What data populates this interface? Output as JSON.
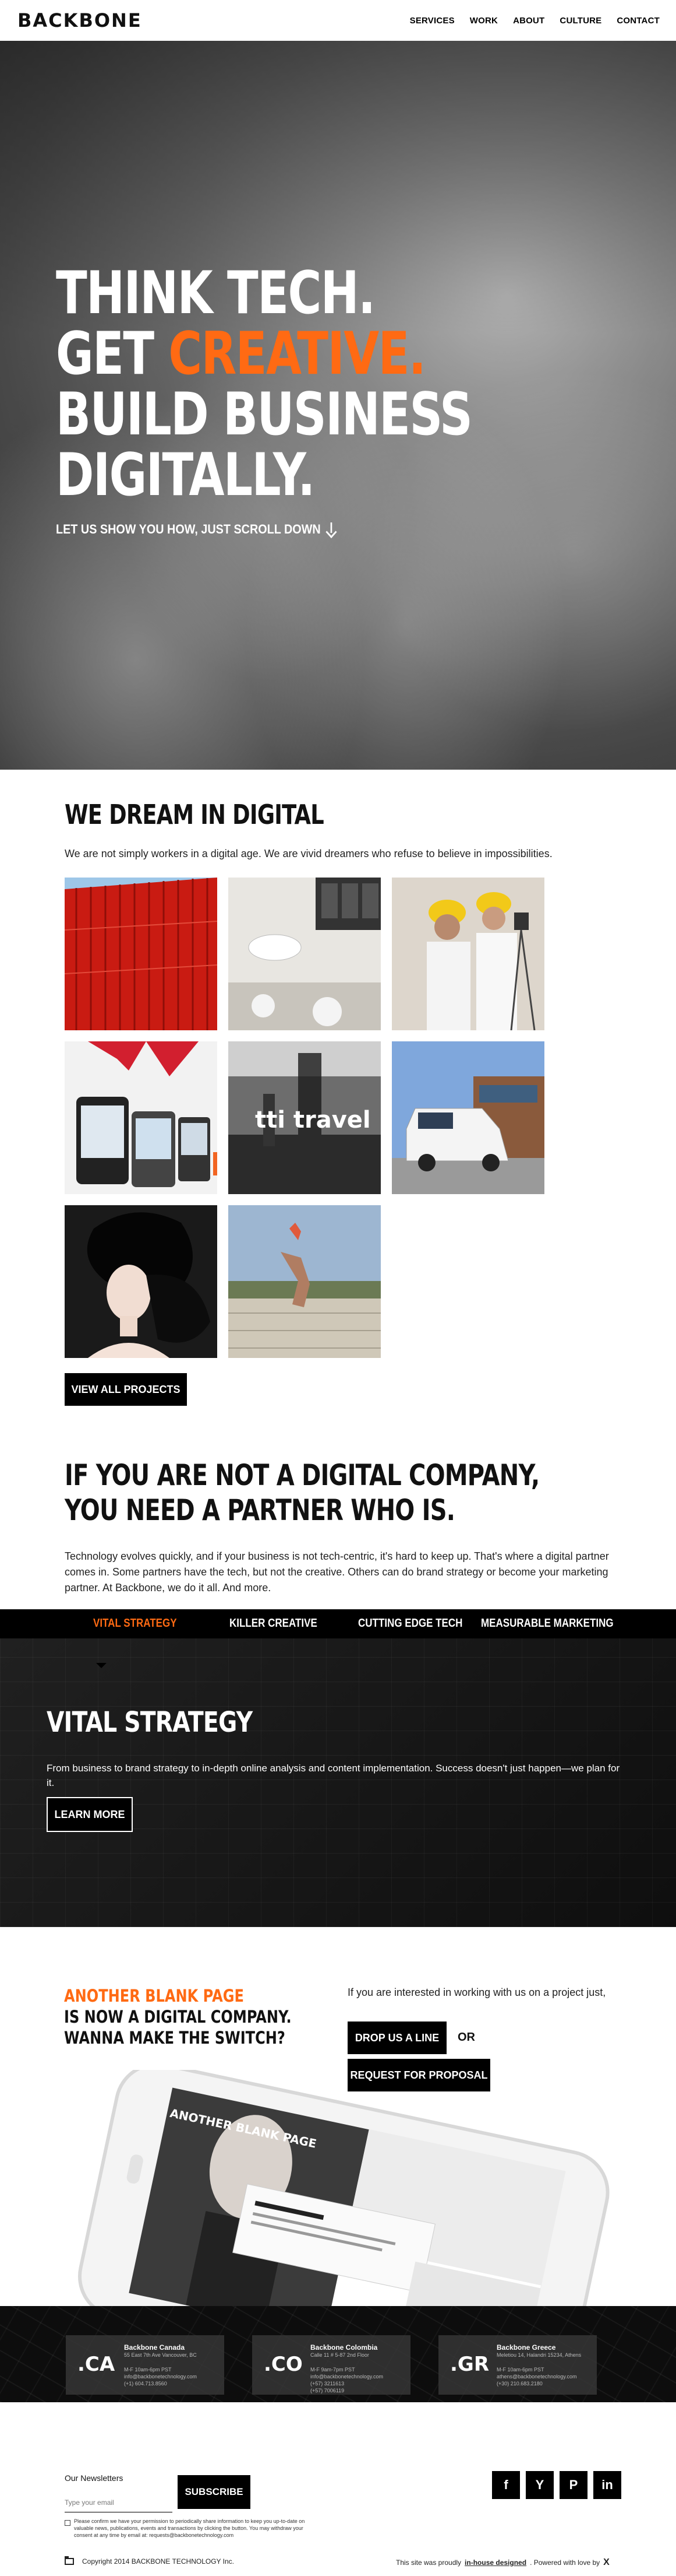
{
  "header": {
    "logo": "BACKBONE",
    "nav": [
      "SERVICES",
      "WORK",
      "ABOUT",
      "CULTURE",
      "CONTACT"
    ]
  },
  "hero": {
    "line1": "THINK TECH.",
    "line2_prefix": "GET ",
    "line2_highlight": "CREATIVE.",
    "line3": "BUILD BUSINESS",
    "line4": "DIGITALLY.",
    "cta": "LET US SHOW YOU HOW, JUST SCROLL DOWN"
  },
  "dream": {
    "title": "WE DREAM IN DIGITAL",
    "text": "We are not simply workers in a digital age. We are vivid dreamers who refuse to believe in impossibilities.",
    "tiles": [
      {
        "name": "red-containers-photo",
        "icon": "photo-icon"
      },
      {
        "name": "interior-photo",
        "icon": "photo-icon"
      },
      {
        "name": "workers-photo",
        "icon": "photo-icon"
      },
      {
        "name": "mobile-devices-photo",
        "icon": "photo-icon"
      },
      {
        "name": "tti-travel-photo",
        "icon": "photo-icon",
        "text": "tti travel"
      },
      {
        "name": "van-photo",
        "icon": "photo-icon"
      },
      {
        "name": "fashion-photo",
        "icon": "photo-icon"
      },
      {
        "name": "runner-photo",
        "icon": "photo-icon"
      }
    ],
    "view_all": "VIEW ALL PROJECTS"
  },
  "partner": {
    "title_line1": "IF YOU ARE NOT A DIGITAL COMPANY,",
    "title_line2": "YOU NEED A PARTNER WHO IS.",
    "text": "Technology evolves quickly, and if your business is not tech-centric, it's hard to keep up. That's where a digital partner comes in. Some partners have the tech, but not the creative. Others can do brand strategy or become your marketing partner. At Backbone, we do it all. And more."
  },
  "tabs": [
    "VITAL STRATEGY",
    "KILLER CREATIVE",
    "CUTTING EDGE TECH",
    "MEASURABLE MARKETING"
  ],
  "vital": {
    "title": "VITAL STRATEGY",
    "text": "From business to brand strategy to in-depth online analysis and content implementation. Success doesn't just happen—we plan for it.",
    "button": "LEARN MORE"
  },
  "abp": {
    "headline_highlight": "ANOTHER BLANK PAGE",
    "headline_line2": "IS NOW A DIGITAL COMPANY.",
    "headline_line3": "WANNA MAKE THE SWITCH?",
    "interest": "If you are interested in working with us on a project just,",
    "drop_line": "DROP US A LINE",
    "or": "OR",
    "request": "REQUEST FOR PROPOSAL",
    "mock_brand": "ANOTHER BLANK PAGE"
  },
  "offices": [
    {
      "code": ".CA",
      "name": "Backbone Canada",
      "addr": "55 East 7th Ave Vancouver, BC",
      "info": "M-F 10am-6pm PST\ninfo@backbonetechnology.com\n(+1) 604.713.8560"
    },
    {
      "code": ".CO",
      "name": "Backbone Colombia",
      "addr": "Calle 11 # 5-87 2nd Floor",
      "info": "M-F 9am-7pm PST\ninfo@backbonetechnology.com\n(+57) 3211613\n(+57) 7006119"
    },
    {
      "code": ".GR",
      "name": "Backbone Greece",
      "addr": "Meletiou 14, Halandri 15234, Athens",
      "info": "M-F 10am-6pm PST\nathens@backbonetechnology.com\n(+30) 210.683.2180"
    }
  ],
  "footer": {
    "newsletter_label": "Our Newsletters",
    "email_placeholder": "Type your email",
    "subscribe": "SUBSCRIBE",
    "consent": "Please confirm we have your permission to periodically share information to keep you up-to-date on valuable news, publications, events and transactions by clicking the button. You may withdraw your consent at any time by email at: requests@backbonetechnology.com",
    "socials": [
      {
        "label": "f",
        "name": "facebook-icon"
      },
      {
        "label": "Y",
        "name": "twitter-icon"
      },
      {
        "label": "P",
        "name": "pinterest-icon"
      },
      {
        "label": "in",
        "name": "linkedin-icon"
      }
    ],
    "copyright": "Copyright 2014 BACKBONE TECHNOLOGY Inc.",
    "powered_prefix": "This site was proudly",
    "powered_link": "in-house designed",
    "powered_suffix": ". Powered with love by",
    "powered_icon": "X"
  },
  "colors": {
    "accent": "#ff6a13",
    "dark": "#000000"
  }
}
